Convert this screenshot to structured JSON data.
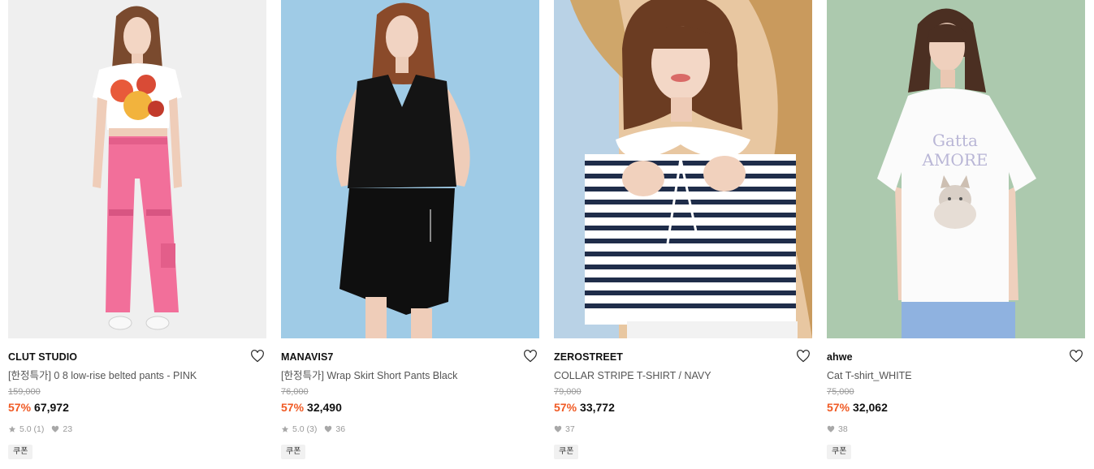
{
  "products": [
    {
      "brand": "CLUT STUDIO",
      "title": "[한정특가] 0 8 low-rise belted pants - PINK",
      "original_price": "159,000",
      "discount": "57%",
      "sale_price": "67,972",
      "rating": "5.0",
      "review_count": "(1)",
      "likes": "23",
      "coupon": "쿠폰",
      "photo_bg": "#efefef",
      "icons": [
        "heart-outline-icon",
        "star-icon",
        "heart-filled-icon"
      ]
    },
    {
      "brand": "MANAVIS7",
      "title": "[한정특가] Wrap Skirt Short Pants Black",
      "original_price": "76,000",
      "discount": "57%",
      "sale_price": "32,490",
      "rating": "5.0",
      "review_count": "(3)",
      "likes": "36",
      "coupon": "쿠폰",
      "photo_bg": "#9fcbe6",
      "icons": [
        "heart-outline-icon",
        "star-icon",
        "heart-filled-icon"
      ]
    },
    {
      "brand": "ZEROSTREET",
      "title": "COLLAR STRIPE T-SHIRT / NAVY",
      "original_price": "79,000",
      "discount": "57%",
      "sale_price": "33,772",
      "likes": "37",
      "coupon": "쿠폰",
      "photo_bg": "#e8c7a1",
      "icons": [
        "heart-outline-icon",
        "heart-filled-icon"
      ]
    },
    {
      "brand": "ahwe",
      "title": "Cat T-shirt_WHITE",
      "original_price": "75,000",
      "discount": "57%",
      "sale_price": "32,062",
      "likes": "38",
      "coupon": "쿠폰",
      "photo_bg": "#acc9ae",
      "icons": [
        "heart-outline-icon",
        "heart-filled-icon"
      ]
    }
  ],
  "colors": {
    "discount": "#f05a24",
    "muted": "#999999",
    "coupon_bg": "#f1f1f1"
  }
}
